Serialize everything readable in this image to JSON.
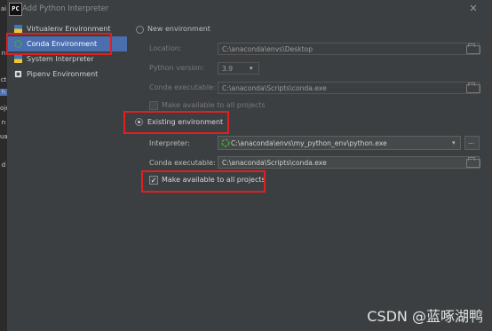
{
  "window": {
    "title": "Add Python Interpreter",
    "close_glyph": "✕",
    "app_icon_label": "PC"
  },
  "left_strip_chars": [
    "ai",
    "n",
    "ct",
    "h",
    "oje",
    "n",
    "ua",
    "d"
  ],
  "sidebar": {
    "items": [
      {
        "label": "Virtualenv Environment",
        "icon": "virtualenv-icon"
      },
      {
        "label": "Conda Environment",
        "icon": "conda-icon",
        "selected": true
      },
      {
        "label": "System Interpreter",
        "icon": "python-icon"
      },
      {
        "label": "Pipenv Environment",
        "icon": "pipenv-icon"
      }
    ]
  },
  "new_env": {
    "radio_label": "New environment",
    "location_label": "Location:",
    "location_value": "C:\\anaconda\\envs\\Desktop",
    "python_version_label": "Python version:",
    "python_version_value": "3.9",
    "conda_exec_label": "Conda executable:",
    "conda_exec_value": "C:\\anaconda\\Scripts\\conda.exe",
    "make_available_label": "Make available to all projects"
  },
  "existing_env": {
    "radio_label": "Existing environment",
    "interpreter_label": "Interpreter:",
    "interpreter_value": "C:\\anaconda\\envs\\my_python_env\\python.exe",
    "more_button": "...",
    "conda_exec_label": "Conda executable:",
    "conda_exec_value": "C:\\anaconda\\Scripts\\conda.exe",
    "make_available_label": "Make available to all projects",
    "make_available_checked": "✓"
  },
  "watermark": "CSDN @蓝啄湖鸭",
  "colors": {
    "selection": "#4b6eaf",
    "highlight": "#e02020"
  }
}
